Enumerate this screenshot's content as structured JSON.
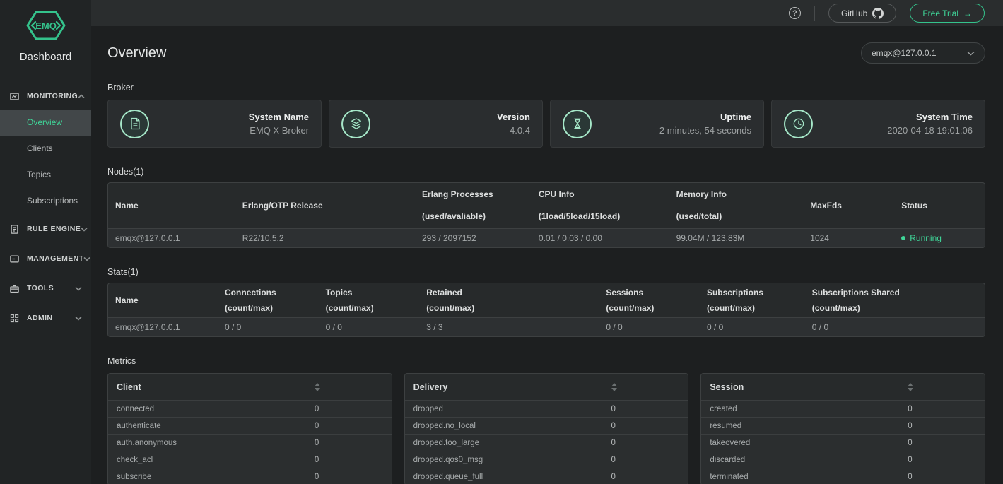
{
  "colors": {
    "accent_green": "#34c38c",
    "mint_icon": "#a5e7c8",
    "status_running": "#3fd598",
    "sidebar_bg": "#212425",
    "topbar_bg": "#2a2d2e",
    "main_bg": "#1d1f20"
  },
  "brand": {
    "logo_text": "EMQ",
    "app_title": "Dashboard"
  },
  "topbar": {
    "help_icon": "?",
    "github_label": "GitHub",
    "free_trial_label": "Free Trial",
    "free_trial_arrow": "→"
  },
  "sidebar": {
    "groups": [
      {
        "label": "MONITORING",
        "icon": "monitor-chart-icon",
        "state": "expanded",
        "items": [
          {
            "label": "Overview",
            "active": true
          },
          {
            "label": "Clients"
          },
          {
            "label": "Topics"
          },
          {
            "label": "Subscriptions"
          }
        ]
      },
      {
        "label": "RULE ENGINE",
        "icon": "document-lines-icon",
        "state": "collapsed"
      },
      {
        "label": "MANAGEMENT",
        "icon": "panel-icon",
        "state": "collapsed"
      },
      {
        "label": "TOOLS",
        "icon": "briefcase-icon",
        "state": "collapsed"
      },
      {
        "label": "ADMIN",
        "icon": "grid-icon",
        "state": "collapsed"
      }
    ]
  },
  "page": {
    "title": "Overview",
    "node_select": {
      "value": "emqx@127.0.0.1"
    },
    "broker": {
      "section_label": "Broker",
      "cards": [
        {
          "icon": "document-icon",
          "title": "System Name",
          "value": "EMQ X Broker"
        },
        {
          "icon": "layers-icon",
          "title": "Version",
          "value": "4.0.4"
        },
        {
          "icon": "hourglass-icon",
          "title": "Uptime",
          "value": "2 minutes, 54 seconds"
        },
        {
          "icon": "clock-icon",
          "title": "System Time",
          "value": "2020-04-18 19:01:06"
        }
      ]
    },
    "nodes": {
      "section_label": "Nodes(1)",
      "columns": [
        {
          "line1": "Name",
          "line2": ""
        },
        {
          "line1": "Erlang/OTP Release",
          "line2": ""
        },
        {
          "line1": "Erlang Processes",
          "line2": "(used/avaliable)"
        },
        {
          "line1": "CPU Info",
          "line2": "(1load/5load/15load)"
        },
        {
          "line1": "Memory Info",
          "line2": "(used/total)"
        },
        {
          "line1": "MaxFds",
          "line2": ""
        },
        {
          "line1": "Status",
          "line2": ""
        }
      ],
      "row": {
        "name": "emqx@127.0.0.1",
        "otp_release": "R22/10.5.2",
        "erlang_processes": "293 / 2097152",
        "cpu_info": "0.01 / 0.03 / 0.00",
        "memory_info": "99.04M / 123.83M",
        "max_fds": "1024",
        "status": "Running"
      }
    },
    "stats": {
      "section_label": "Stats(1)",
      "columns": [
        {
          "line1": "Name",
          "line2": ""
        },
        {
          "line1": "Connections",
          "line2": "(count/max)"
        },
        {
          "line1": "Topics",
          "line2": "(count/max)"
        },
        {
          "line1": "Retained",
          "line2": "(count/max)"
        },
        {
          "line1": "Sessions",
          "line2": "(count/max)"
        },
        {
          "line1": "Subscriptions",
          "line2": "(count/max)"
        },
        {
          "line1": "Subscriptions Shared",
          "line2": "(count/max)"
        }
      ],
      "row": {
        "name": "emqx@127.0.0.1",
        "connections": "0 / 0",
        "topics": "0 / 0",
        "retained": "3 / 3",
        "sessions": "0 / 0",
        "subscriptions": "0 / 0",
        "subscriptions_shared": "0 / 0"
      }
    },
    "metrics": {
      "section_label": "Metrics",
      "tables": [
        {
          "header": "Client",
          "rows": [
            {
              "key": "connected",
              "value": "0"
            },
            {
              "key": "authenticate",
              "value": "0"
            },
            {
              "key": "auth.anonymous",
              "value": "0"
            },
            {
              "key": "check_acl",
              "value": "0"
            },
            {
              "key": "subscribe",
              "value": "0"
            }
          ]
        },
        {
          "header": "Delivery",
          "rows": [
            {
              "key": "dropped",
              "value": "0"
            },
            {
              "key": "dropped.no_local",
              "value": "0"
            },
            {
              "key": "dropped.too_large",
              "value": "0"
            },
            {
              "key": "dropped.qos0_msg",
              "value": "0"
            },
            {
              "key": "dropped.queue_full",
              "value": "0"
            }
          ]
        },
        {
          "header": "Session",
          "rows": [
            {
              "key": "created",
              "value": "0"
            },
            {
              "key": "resumed",
              "value": "0"
            },
            {
              "key": "takeovered",
              "value": "0"
            },
            {
              "key": "discarded",
              "value": "0"
            },
            {
              "key": "terminated",
              "value": "0"
            }
          ]
        }
      ]
    }
  }
}
